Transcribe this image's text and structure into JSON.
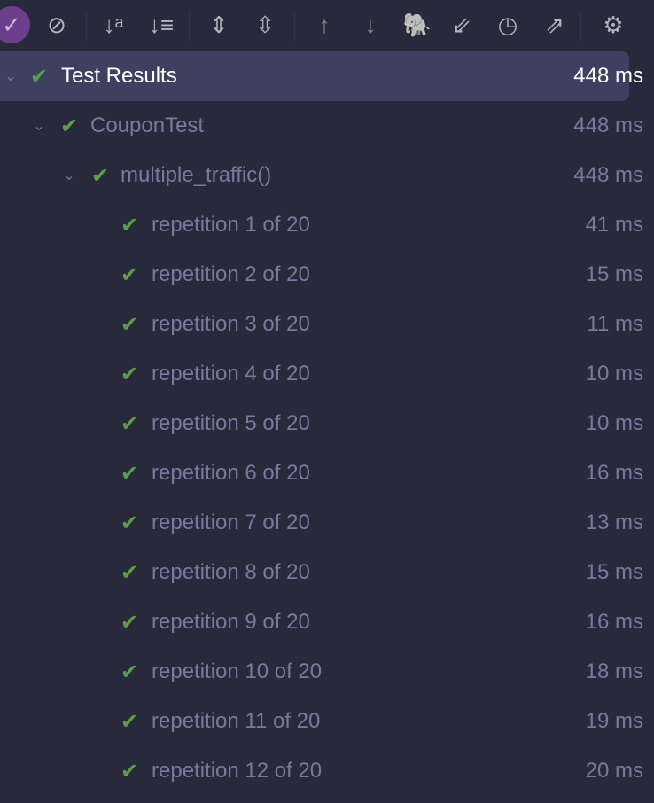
{
  "toolbar": {
    "buttons": [
      {
        "name": "tests-passed-icon",
        "glyph": "✓"
      },
      {
        "name": "show-ignored-icon",
        "glyph": "⊘"
      },
      {
        "name": "sort-alphabetically-icon",
        "glyph": "↓ᵃ"
      },
      {
        "name": "sort-by-duration-icon",
        "glyph": "↓≡"
      },
      {
        "name": "expand-all-icon",
        "glyph": "⇕"
      },
      {
        "name": "collapse-all-icon",
        "glyph": "⇳"
      },
      {
        "name": "previous-failed-icon",
        "glyph": "↑"
      },
      {
        "name": "next-failed-icon",
        "glyph": "↓"
      },
      {
        "name": "import-gradle-icon",
        "glyph": "🐘"
      },
      {
        "name": "import-tests-icon",
        "glyph": "⇙"
      },
      {
        "name": "test-history-icon",
        "glyph": "◷"
      },
      {
        "name": "export-tests-icon",
        "glyph": "⇗"
      },
      {
        "name": "settings-gear-icon",
        "glyph": "⚙"
      }
    ]
  },
  "tree": {
    "root": {
      "label": "Test Results",
      "time": "448 ms"
    },
    "suite": {
      "label": "CouponTest",
      "time": "448 ms"
    },
    "method": {
      "label": "multiple_traffic()",
      "time": "448 ms"
    },
    "repetitions": [
      {
        "label": "repetition 1 of 20",
        "time": "41 ms"
      },
      {
        "label": "repetition 2 of 20",
        "time": "15 ms"
      },
      {
        "label": "repetition 3 of 20",
        "time": "11 ms"
      },
      {
        "label": "repetition 4 of 20",
        "time": "10 ms"
      },
      {
        "label": "repetition 5 of 20",
        "time": "10 ms"
      },
      {
        "label": "repetition 6 of 20",
        "time": "16 ms"
      },
      {
        "label": "repetition 7 of 20",
        "time": "13 ms"
      },
      {
        "label": "repetition 8 of 20",
        "time": "15 ms"
      },
      {
        "label": "repetition 9 of 20",
        "time": "16 ms"
      },
      {
        "label": "repetition 10 of 20",
        "time": "18 ms"
      },
      {
        "label": "repetition 11 of 20",
        "time": "19 ms"
      },
      {
        "label": "repetition 12 of 20",
        "time": "20 ms"
      }
    ]
  },
  "colors": {
    "background": "#282a3b",
    "selected": "#3d4060",
    "pass": "#5c9c4a",
    "text": "#767a9e"
  }
}
